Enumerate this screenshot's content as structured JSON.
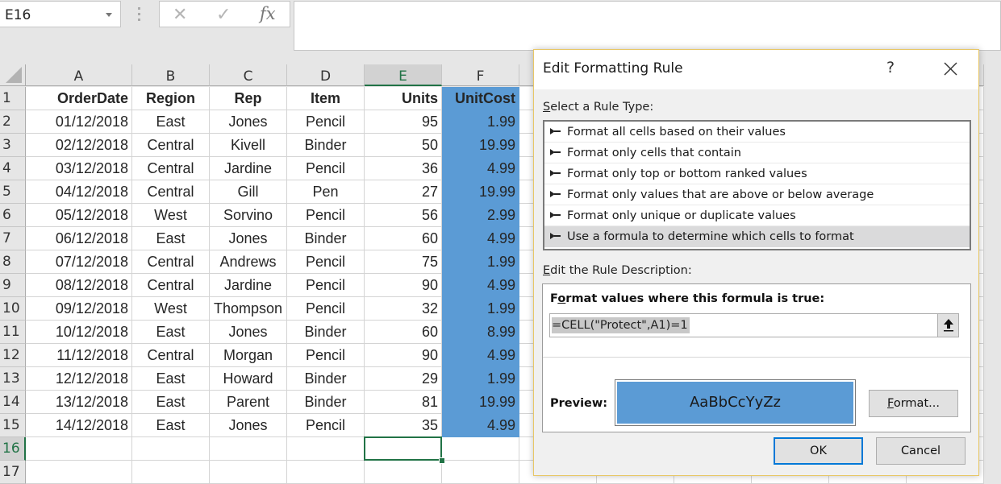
{
  "formula_bar": {
    "name_box": "E16",
    "cancel_icon": "✕",
    "enter_icon": "✓",
    "fx_label": "fx",
    "formula": ""
  },
  "sheet": {
    "columns": [
      "A",
      "B",
      "C",
      "D",
      "E",
      "F"
    ],
    "selected_column": "E",
    "active_cell": "E16",
    "row_numbers": [
      "1",
      "2",
      "3",
      "4",
      "5",
      "6",
      "7",
      "8",
      "9",
      "10",
      "11",
      "12",
      "13",
      "14",
      "15",
      "16",
      "17"
    ],
    "headers": [
      "OrderDate",
      "Region",
      "Rep",
      "Item",
      "Units",
      "UnitCost"
    ],
    "rows": [
      [
        "01/12/2018",
        "East",
        "Jones",
        "Pencil",
        "95",
        "1.99"
      ],
      [
        "02/12/2018",
        "Central",
        "Kivell",
        "Binder",
        "50",
        "19.99"
      ],
      [
        "03/12/2018",
        "Central",
        "Jardine",
        "Pencil",
        "36",
        "4.99"
      ],
      [
        "04/12/2018",
        "Central",
        "Gill",
        "Pen",
        "27",
        "19.99"
      ],
      [
        "05/12/2018",
        "West",
        "Sorvino",
        "Pencil",
        "56",
        "2.99"
      ],
      [
        "06/12/2018",
        "East",
        "Jones",
        "Binder",
        "60",
        "4.99"
      ],
      [
        "07/12/2018",
        "Central",
        "Andrews",
        "Pencil",
        "75",
        "1.99"
      ],
      [
        "08/12/2018",
        "Central",
        "Jardine",
        "Pencil",
        "90",
        "4.99"
      ],
      [
        "09/12/2018",
        "West",
        "Thompson",
        "Pencil",
        "32",
        "1.99"
      ],
      [
        "10/12/2018",
        "East",
        "Jones",
        "Binder",
        "60",
        "8.99"
      ],
      [
        "11/12/2018",
        "Central",
        "Morgan",
        "Pencil",
        "90",
        "4.99"
      ],
      [
        "12/12/2018",
        "East",
        "Howard",
        "Binder",
        "29",
        "1.99"
      ],
      [
        "13/12/2018",
        "East",
        "Parent",
        "Binder",
        "81",
        "19.99"
      ],
      [
        "14/12/2018",
        "East",
        "Jones",
        "Pencil",
        "35",
        "4.99"
      ]
    ],
    "highlight_color": "#5b9bd5",
    "selection_color": "#217346"
  },
  "dialog": {
    "title": "Edit Formatting Rule",
    "help_label": "?",
    "select_rule_type_label_accel": "S",
    "select_rule_type_label_rest": "elect a Rule Type:",
    "rule_types": [
      "Format all cells based on their values",
      "Format only cells that contain",
      "Format only top or bottom ranked values",
      "Format only values that are above or below average",
      "Format only unique or duplicate values",
      "Use a formula to determine which cells to format"
    ],
    "selected_rule_index": 5,
    "edit_desc_label_accel": "E",
    "edit_desc_label_rest": "dit the Rule Description:",
    "formula_heading_pre": "F",
    "formula_heading_accel": "o",
    "formula_heading_rest": "rmat values where this formula is true:",
    "formula_value": "=CELL(\"Protect\",A1)=1",
    "preview_label": "Preview:",
    "preview_text": "AaBbCcYyZz",
    "preview_fill": "#5b9bd5",
    "format_button_accel": "F",
    "format_button_rest": "ormat...",
    "ok_label": "OK",
    "cancel_label": "Cancel"
  }
}
